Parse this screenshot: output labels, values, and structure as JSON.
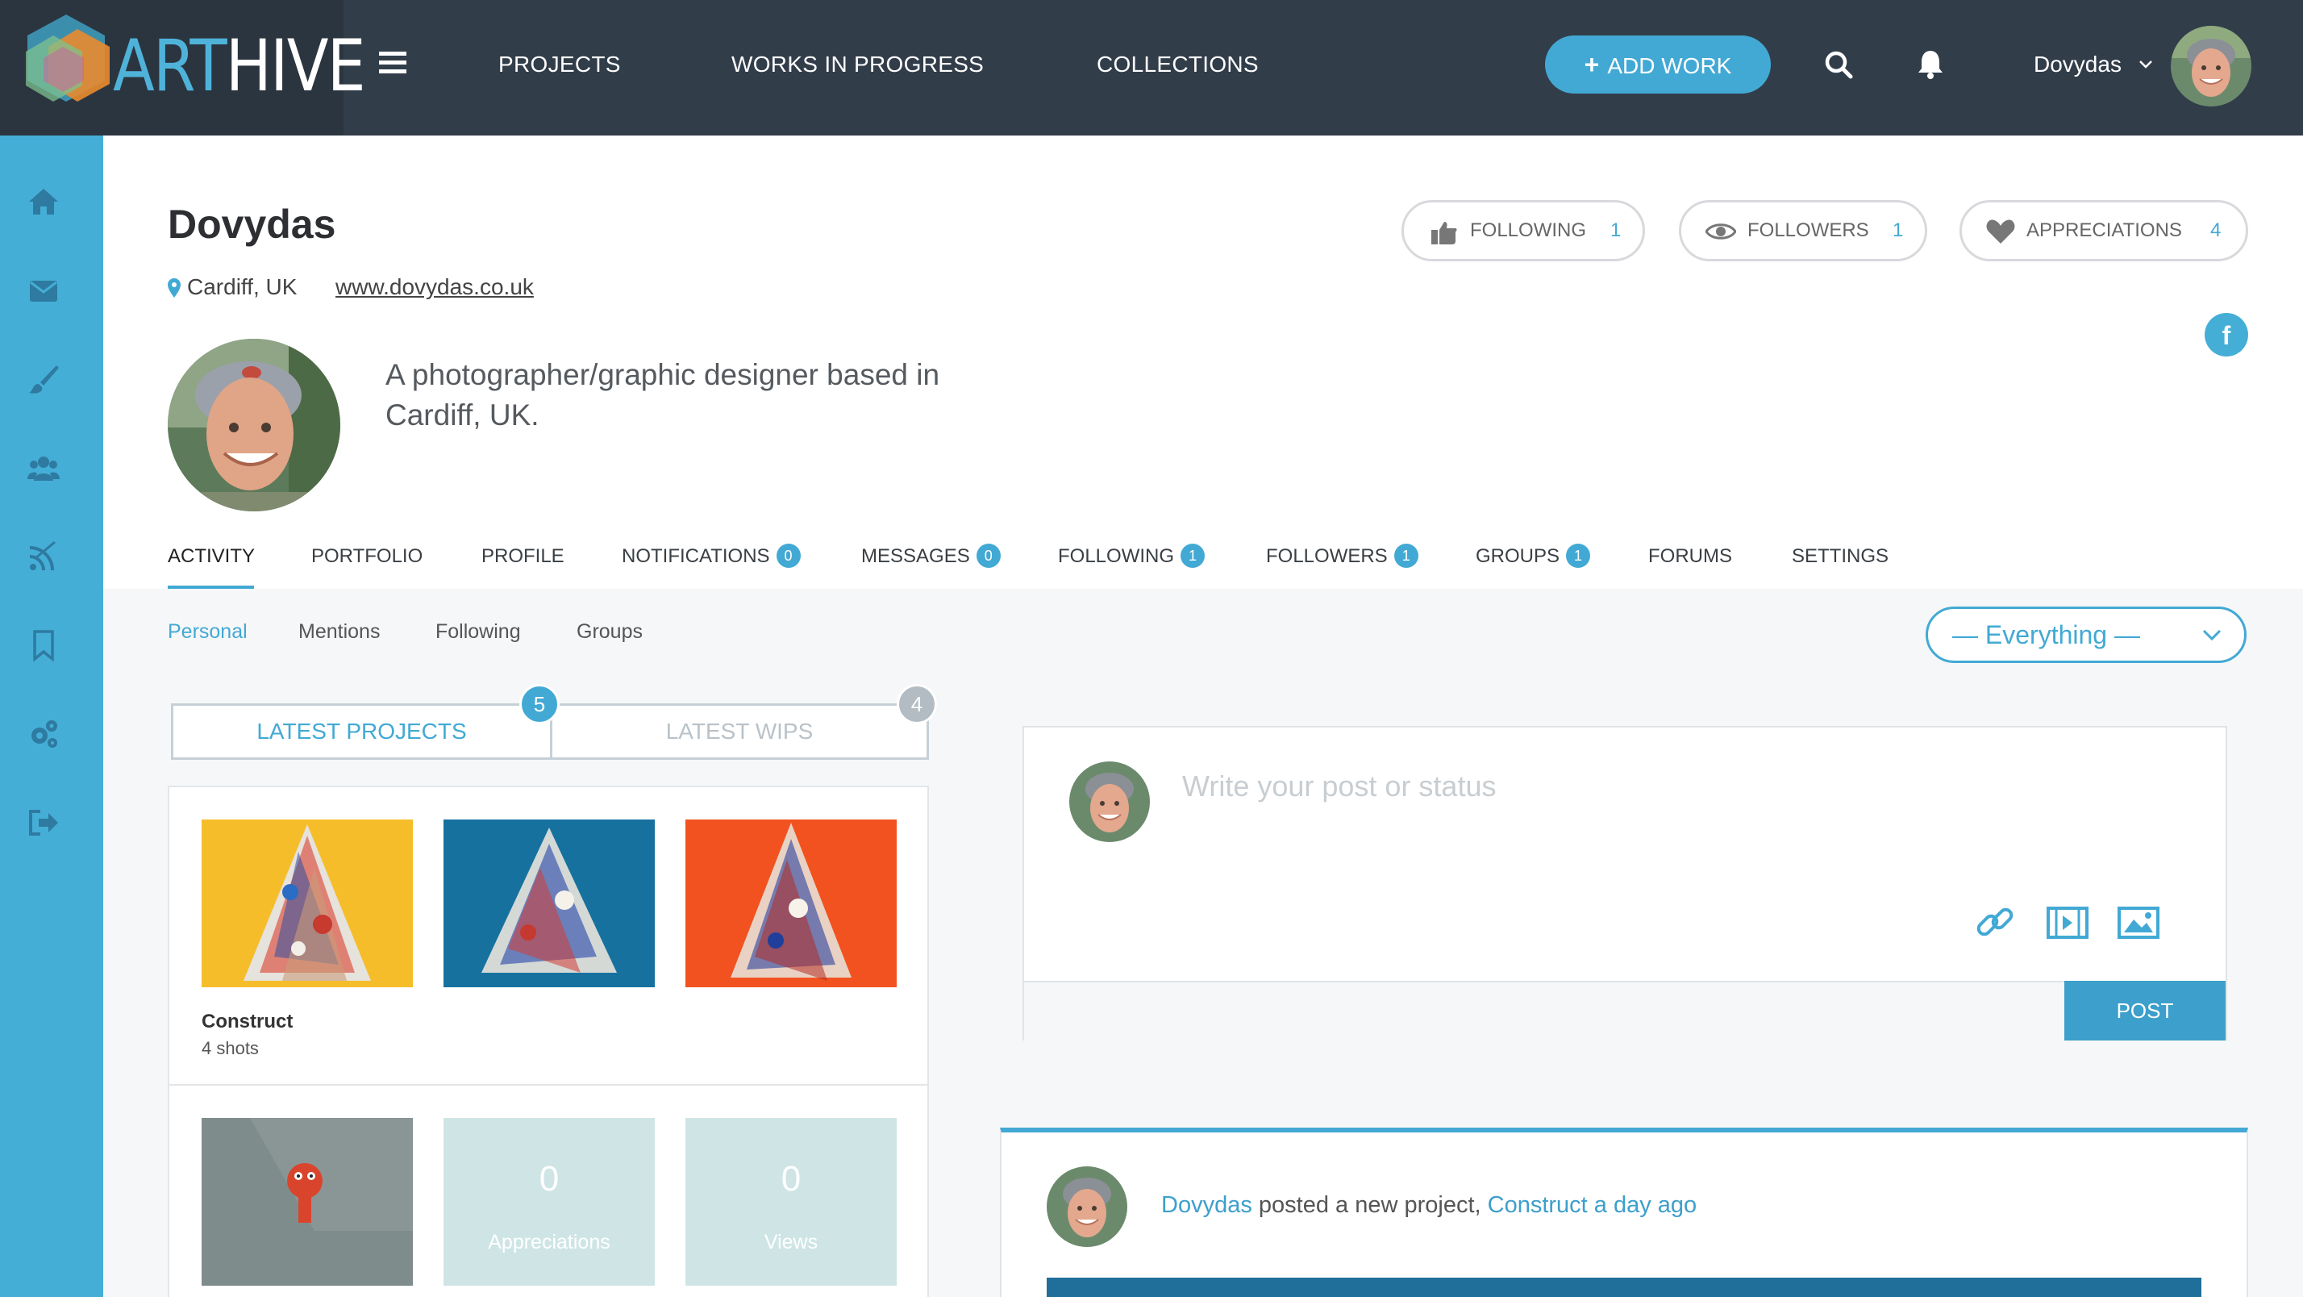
{
  "brand": {
    "logo_part1": "ART",
    "logo_part2": "HIVE",
    "colors": {
      "topbar": "#323d4a",
      "accent": "#42a9d4",
      "sidebar": "#45aed6"
    }
  },
  "topnav": {
    "links": [
      "PROJECTS",
      "WORKS IN PROGRESS",
      "COLLECTIONS"
    ],
    "add_work_label": "ADD WORK",
    "user_name": "Dovydas",
    "icons": [
      "menu-icon",
      "search-icon",
      "bell-icon",
      "chevron-down-icon"
    ]
  },
  "sidebar": {
    "icons": [
      "home-icon",
      "envelope-icon",
      "brush-icon",
      "group-icon",
      "feed-icon",
      "bookmark-icon",
      "gears-icon",
      "logout-icon"
    ]
  },
  "profile": {
    "name": "Dovydas",
    "location": "Cardiff, UK",
    "website": "www.dovydas.co.uk",
    "bio": "A photographer/graphic designer based in Cardiff, UK."
  },
  "stats": {
    "following_label": "FOLLOWING",
    "following_count": "1",
    "followers_label": "FOLLOWERS",
    "followers_count": "1",
    "appreciations_label": "APPRECIATIONS",
    "appreciations_count": "4",
    "social_icon": "f"
  },
  "tabs": [
    {
      "label": "ACTIVITY"
    },
    {
      "label": "PORTFOLIO"
    },
    {
      "label": "PROFILE"
    },
    {
      "label": "NOTIFICATIONS",
      "badge": "0"
    },
    {
      "label": "MESSAGES",
      "badge": "0"
    },
    {
      "label": "FOLLOWING",
      "badge": "1"
    },
    {
      "label": "FOLLOWERS",
      "badge": "1"
    },
    {
      "label": "GROUPS",
      "badge": "1"
    },
    {
      "label": "FORUMS"
    },
    {
      "label": "SETTINGS"
    }
  ],
  "subtabs": [
    "Personal",
    "Mentions",
    "Following",
    "Groups"
  ],
  "filter": {
    "selected": "— Everything —"
  },
  "projects_panel": {
    "latest_projects_label": "LATEST PROJECTS",
    "latest_projects_count": "5",
    "latest_wips_label": "LATEST WIPS",
    "latest_wips_count": "4",
    "project_title": "Construct",
    "project_shots": "4 shots",
    "stats": [
      {
        "value": "0",
        "label": "Appreciations"
      },
      {
        "value": "0",
        "label": "Views"
      }
    ]
  },
  "composer": {
    "placeholder": "Write your post or status",
    "post_label": "POST",
    "tools": [
      "link-icon",
      "video-icon",
      "image-icon"
    ]
  },
  "activity": {
    "actor": "Dovydas",
    "action": " posted a new project, ",
    "project_link": "Construct",
    "time": " a day ago"
  }
}
